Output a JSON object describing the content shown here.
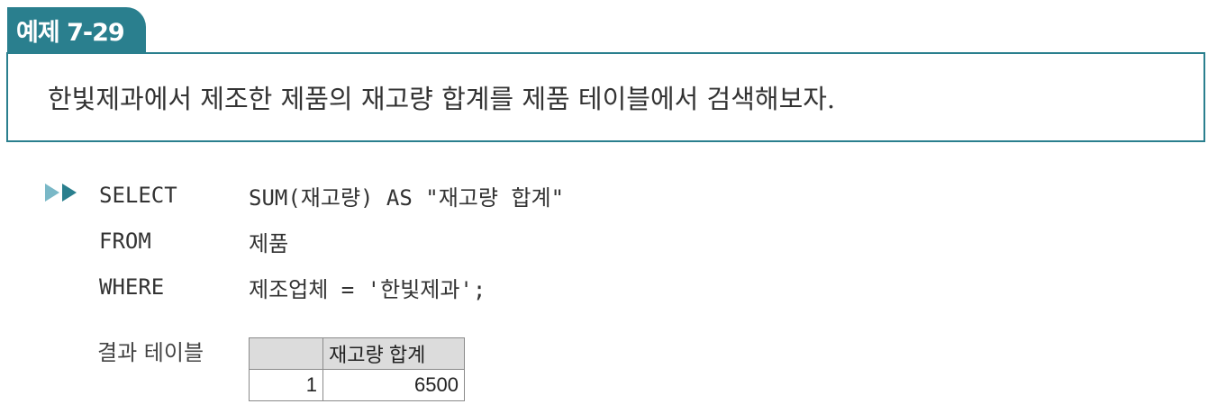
{
  "example_tab": {
    "label": "예제 7-29"
  },
  "question": {
    "text": "한빛제과에서 제조한 제품의 재고량 합계를 제품 테이블에서 검색해보자."
  },
  "code": {
    "arrow_icon": "double-play-arrow-icon",
    "lines": [
      {
        "keyword": "SELECT",
        "rest": "SUM(재고량)  AS \"재고량 합계\""
      },
      {
        "keyword": "FROM",
        "rest": "제품"
      },
      {
        "keyword": "WHERE",
        "rest": "제조업체 = '한빛제과';"
      }
    ]
  },
  "result": {
    "label": "결과 테이블",
    "columns": [
      "",
      "재고량 합계"
    ],
    "rows": [
      [
        "1",
        "6500"
      ]
    ]
  },
  "colors": {
    "accent": "#2a7f8e",
    "accent_light": "#7ab8c7",
    "header_bg": "#dcdcdc"
  }
}
